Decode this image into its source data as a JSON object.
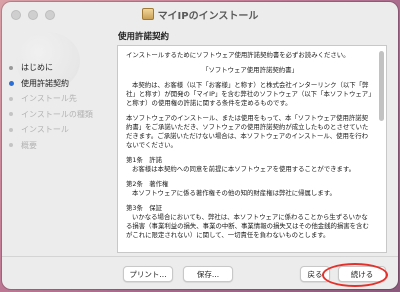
{
  "window": {
    "title": "マイIPのインストール"
  },
  "sidebar": {
    "steps": [
      {
        "label": "はじめに",
        "state": "done"
      },
      {
        "label": "使用許諾契約",
        "state": "active"
      },
      {
        "label": "インストール先",
        "state": "pending"
      },
      {
        "label": "インストールの種類",
        "state": "pending"
      },
      {
        "label": "インストール",
        "state": "pending"
      },
      {
        "label": "概要",
        "state": "pending"
      }
    ]
  },
  "main": {
    "pane_title": "使用許諾契約",
    "license": {
      "intro": "インストールするためにソフトウェア使用許諾契約書を必ずお読みください。",
      "doc_title": "「ソフトウェア使用許諾契約書」",
      "p1": "本契約は、お客様（以下「お客様」と称す）と株式会社インターリンク（以下「弊社」と称す）が開発の「マイIP」を含む弊社のソフトウェア（以下「本ソフトウェア」と称す）の使用権の許諾に関する条件を定めるものです。",
      "p2": "本ソフトウェアのインストール、または使用をもって、本「ソフトウェア使用許諾契約書」をご承諾いただき、ソフトウェアの使用許諾契約が成立したものとさせていただきます。ご承諾いただけない場合は、本ソフトウェアのインストール、使用を行わないでください。",
      "art1_head": "第1条　許諾",
      "art1_body": "お客様は本契約への同意を前提に本ソフトウェアを使用することができます。",
      "art2_head": "第2条　著作権",
      "art2_body": "本ソフトウェアに係る著作権その他の知的財産権は弊社に帰属します。",
      "art3_head": "第3条　保証",
      "art3_body": "いかなる場合においても、弊社は、本ソフトウェアに係わることから生ずるいかなる損害（事業利益の損失、事業の中断、事業情報の損失又はその他金銭的損害を含むがこれに限定されない）に関して、一切責任を負わないものとします。"
    }
  },
  "footer": {
    "print_label": "プリント...",
    "save_label": "保存...",
    "back_label": "戻る",
    "continue_label": "続ける"
  }
}
